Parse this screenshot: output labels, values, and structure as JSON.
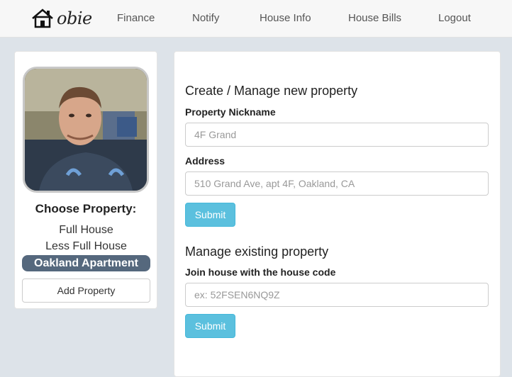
{
  "navbar": {
    "brand": "obie",
    "links": [
      "Finance",
      "Notify",
      "House Info",
      "House Bills",
      "Logout"
    ]
  },
  "sidebar": {
    "title": "Choose Property:",
    "properties": [
      "Full House",
      "Less Full House",
      "Oakland Apartment"
    ],
    "active_property": "Oakland Apartment",
    "add_button": "Add Property"
  },
  "create": {
    "heading": "Create / Manage new property",
    "nickname_label": "Property Nickname",
    "nickname_placeholder": "4F Grand",
    "address_label": "Address",
    "address_placeholder": "510 Grand Ave, apt 4F, Oakland, CA",
    "submit": "Submit"
  },
  "existing": {
    "heading": "Manage existing property",
    "code_label": "Join house with the house code",
    "code_placeholder": "ex: 52FSEN6NQ9Z",
    "submit": "Submit"
  },
  "colors": {
    "accent": "#5bc0de",
    "active_property_bg": "#55687d",
    "page_bg": "#dde3e9"
  }
}
